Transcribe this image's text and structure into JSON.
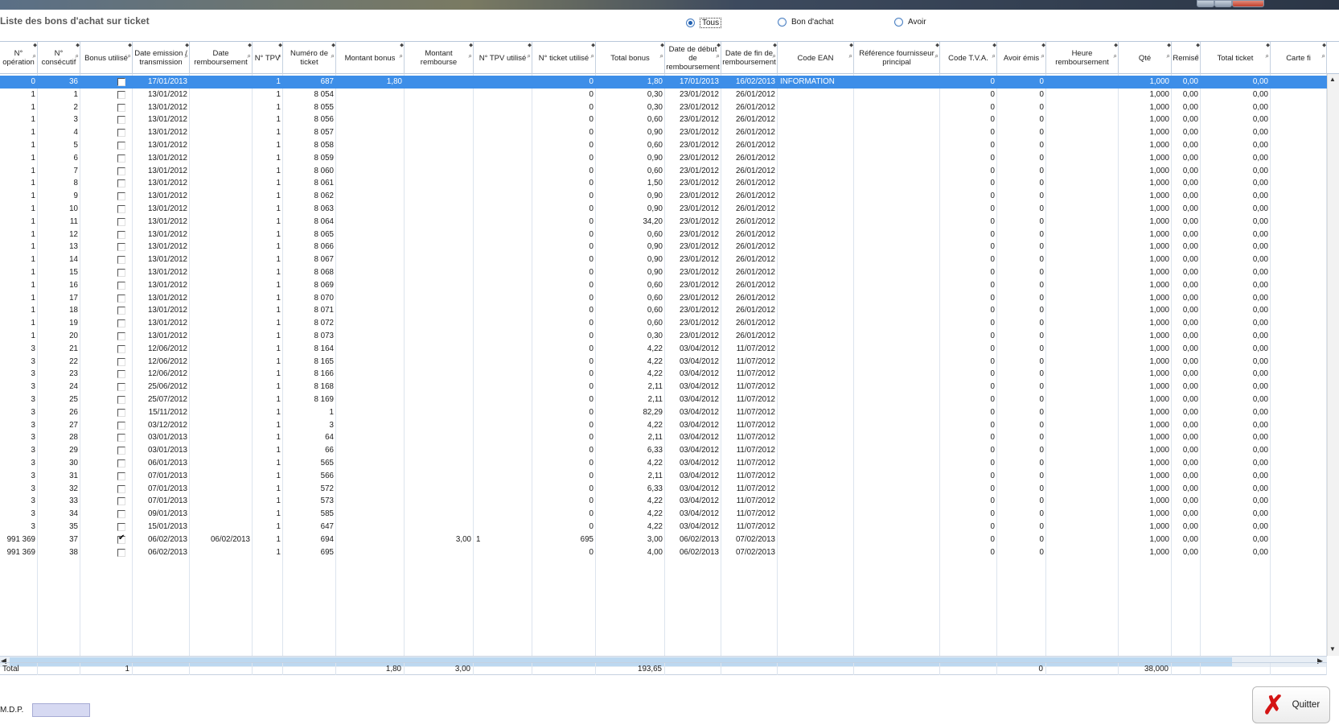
{
  "page": {
    "title": "Liste des bons d'achat sur ticket"
  },
  "filters": [
    {
      "label": "Tous",
      "selected": true
    },
    {
      "label": "Bon d'achat",
      "selected": false
    },
    {
      "label": "Avoir",
      "selected": false
    }
  ],
  "columns": [
    "N° opération",
    "N° consécutif",
    "Bonus utilisé",
    "Date emission / transmission",
    "Date remboursement",
    "N° TPV",
    "Numéro de ticket",
    "Montant bonus",
    "Montant rembourse",
    "N° TPV utilisé",
    "N° ticket utilisé",
    "Total bonus",
    "Date de début de remboursement",
    "Date de fin de remboursement",
    "Code EAN",
    "Référence fournisseur principal",
    "Code T.V.A.",
    "Avoir émis",
    "Heure remboursement",
    "Qté",
    "Remise",
    "Total ticket",
    "Carte fi"
  ],
  "rows": [
    [
      "0",
      "36",
      false,
      "17/01/2013",
      "",
      "1",
      "687",
      "1,80",
      "",
      "",
      "0",
      "1,80",
      "17/01/2013",
      "16/02/2013",
      "INFORMATION",
      "",
      "0",
      "0",
      "",
      "1,000",
      "0,00",
      "0,00"
    ],
    [
      "1",
      "1",
      false,
      "13/01/2012",
      "",
      "1",
      "8 054",
      "",
      "",
      "",
      "0",
      "0,30",
      "23/01/2012",
      "26/01/2012",
      "",
      "",
      "0",
      "0",
      "",
      "1,000",
      "0,00",
      "0,00"
    ],
    [
      "1",
      "2",
      false,
      "13/01/2012",
      "",
      "1",
      "8 055",
      "",
      "",
      "",
      "0",
      "0,30",
      "23/01/2012",
      "26/01/2012",
      "",
      "",
      "0",
      "0",
      "",
      "1,000",
      "0,00",
      "0,00"
    ],
    [
      "1",
      "3",
      false,
      "13/01/2012",
      "",
      "1",
      "8 056",
      "",
      "",
      "",
      "0",
      "0,60",
      "23/01/2012",
      "26/01/2012",
      "",
      "",
      "0",
      "0",
      "",
      "1,000",
      "0,00",
      "0,00"
    ],
    [
      "1",
      "4",
      false,
      "13/01/2012",
      "",
      "1",
      "8 057",
      "",
      "",
      "",
      "0",
      "0,90",
      "23/01/2012",
      "26/01/2012",
      "",
      "",
      "0",
      "0",
      "",
      "1,000",
      "0,00",
      "0,00"
    ],
    [
      "1",
      "5",
      false,
      "13/01/2012",
      "",
      "1",
      "8 058",
      "",
      "",
      "",
      "0",
      "0,60",
      "23/01/2012",
      "26/01/2012",
      "",
      "",
      "0",
      "0",
      "",
      "1,000",
      "0,00",
      "0,00"
    ],
    [
      "1",
      "6",
      false,
      "13/01/2012",
      "",
      "1",
      "8 059",
      "",
      "",
      "",
      "0",
      "0,90",
      "23/01/2012",
      "26/01/2012",
      "",
      "",
      "0",
      "0",
      "",
      "1,000",
      "0,00",
      "0,00"
    ],
    [
      "1",
      "7",
      false,
      "13/01/2012",
      "",
      "1",
      "8 060",
      "",
      "",
      "",
      "0",
      "0,60",
      "23/01/2012",
      "26/01/2012",
      "",
      "",
      "0",
      "0",
      "",
      "1,000",
      "0,00",
      "0,00"
    ],
    [
      "1",
      "8",
      false,
      "13/01/2012",
      "",
      "1",
      "8 061",
      "",
      "",
      "",
      "0",
      "1,50",
      "23/01/2012",
      "26/01/2012",
      "",
      "",
      "0",
      "0",
      "",
      "1,000",
      "0,00",
      "0,00"
    ],
    [
      "1",
      "9",
      false,
      "13/01/2012",
      "",
      "1",
      "8 062",
      "",
      "",
      "",
      "0",
      "0,90",
      "23/01/2012",
      "26/01/2012",
      "",
      "",
      "0",
      "0",
      "",
      "1,000",
      "0,00",
      "0,00"
    ],
    [
      "1",
      "10",
      false,
      "13/01/2012",
      "",
      "1",
      "8 063",
      "",
      "",
      "",
      "0",
      "0,90",
      "23/01/2012",
      "26/01/2012",
      "",
      "",
      "0",
      "0",
      "",
      "1,000",
      "0,00",
      "0,00"
    ],
    [
      "1",
      "11",
      false,
      "13/01/2012",
      "",
      "1",
      "8 064",
      "",
      "",
      "",
      "0",
      "34,20",
      "23/01/2012",
      "26/01/2012",
      "",
      "",
      "0",
      "0",
      "",
      "1,000",
      "0,00",
      "0,00"
    ],
    [
      "1",
      "12",
      false,
      "13/01/2012",
      "",
      "1",
      "8 065",
      "",
      "",
      "",
      "0",
      "0,60",
      "23/01/2012",
      "26/01/2012",
      "",
      "",
      "0",
      "0",
      "",
      "1,000",
      "0,00",
      "0,00"
    ],
    [
      "1",
      "13",
      false,
      "13/01/2012",
      "",
      "1",
      "8 066",
      "",
      "",
      "",
      "0",
      "0,90",
      "23/01/2012",
      "26/01/2012",
      "",
      "",
      "0",
      "0",
      "",
      "1,000",
      "0,00",
      "0,00"
    ],
    [
      "1",
      "14",
      false,
      "13/01/2012",
      "",
      "1",
      "8 067",
      "",
      "",
      "",
      "0",
      "0,90",
      "23/01/2012",
      "26/01/2012",
      "",
      "",
      "0",
      "0",
      "",
      "1,000",
      "0,00",
      "0,00"
    ],
    [
      "1",
      "15",
      false,
      "13/01/2012",
      "",
      "1",
      "8 068",
      "",
      "",
      "",
      "0",
      "0,90",
      "23/01/2012",
      "26/01/2012",
      "",
      "",
      "0",
      "0",
      "",
      "1,000",
      "0,00",
      "0,00"
    ],
    [
      "1",
      "16",
      false,
      "13/01/2012",
      "",
      "1",
      "8 069",
      "",
      "",
      "",
      "0",
      "0,60",
      "23/01/2012",
      "26/01/2012",
      "",
      "",
      "0",
      "0",
      "",
      "1,000",
      "0,00",
      "0,00"
    ],
    [
      "1",
      "17",
      false,
      "13/01/2012",
      "",
      "1",
      "8 070",
      "",
      "",
      "",
      "0",
      "0,60",
      "23/01/2012",
      "26/01/2012",
      "",
      "",
      "0",
      "0",
      "",
      "1,000",
      "0,00",
      "0,00"
    ],
    [
      "1",
      "18",
      false,
      "13/01/2012",
      "",
      "1",
      "8 071",
      "",
      "",
      "",
      "0",
      "0,60",
      "23/01/2012",
      "26/01/2012",
      "",
      "",
      "0",
      "0",
      "",
      "1,000",
      "0,00",
      "0,00"
    ],
    [
      "1",
      "19",
      false,
      "13/01/2012",
      "",
      "1",
      "8 072",
      "",
      "",
      "",
      "0",
      "0,60",
      "23/01/2012",
      "26/01/2012",
      "",
      "",
      "0",
      "0",
      "",
      "1,000",
      "0,00",
      "0,00"
    ],
    [
      "1",
      "20",
      false,
      "13/01/2012",
      "",
      "1",
      "8 073",
      "",
      "",
      "",
      "0",
      "0,30",
      "23/01/2012",
      "26/01/2012",
      "",
      "",
      "0",
      "0",
      "",
      "1,000",
      "0,00",
      "0,00"
    ],
    [
      "3",
      "21",
      false,
      "12/06/2012",
      "",
      "1",
      "8 164",
      "",
      "",
      "",
      "0",
      "4,22",
      "03/04/2012",
      "11/07/2012",
      "",
      "",
      "0",
      "0",
      "",
      "1,000",
      "0,00",
      "0,00"
    ],
    [
      "3",
      "22",
      false,
      "12/06/2012",
      "",
      "1",
      "8 165",
      "",
      "",
      "",
      "0",
      "4,22",
      "03/04/2012",
      "11/07/2012",
      "",
      "",
      "0",
      "0",
      "",
      "1,000",
      "0,00",
      "0,00"
    ],
    [
      "3",
      "23",
      false,
      "12/06/2012",
      "",
      "1",
      "8 166",
      "",
      "",
      "",
      "0",
      "4,22",
      "03/04/2012",
      "11/07/2012",
      "",
      "",
      "0",
      "0",
      "",
      "1,000",
      "0,00",
      "0,00"
    ],
    [
      "3",
      "24",
      false,
      "25/06/2012",
      "",
      "1",
      "8 168",
      "",
      "",
      "",
      "0",
      "2,11",
      "03/04/2012",
      "11/07/2012",
      "",
      "",
      "0",
      "0",
      "",
      "1,000",
      "0,00",
      "0,00"
    ],
    [
      "3",
      "25",
      false,
      "25/07/2012",
      "",
      "1",
      "8 169",
      "",
      "",
      "",
      "0",
      "2,11",
      "03/04/2012",
      "11/07/2012",
      "",
      "",
      "0",
      "0",
      "",
      "1,000",
      "0,00",
      "0,00"
    ],
    [
      "3",
      "26",
      false,
      "15/11/2012",
      "",
      "1",
      "1",
      "",
      "",
      "",
      "0",
      "82,29",
      "03/04/2012",
      "11/07/2012",
      "",
      "",
      "0",
      "0",
      "",
      "1,000",
      "0,00",
      "0,00"
    ],
    [
      "3",
      "27",
      false,
      "03/12/2012",
      "",
      "1",
      "3",
      "",
      "",
      "",
      "0",
      "4,22",
      "03/04/2012",
      "11/07/2012",
      "",
      "",
      "0",
      "0",
      "",
      "1,000",
      "0,00",
      "0,00"
    ],
    [
      "3",
      "28",
      false,
      "03/01/2013",
      "",
      "1",
      "64",
      "",
      "",
      "",
      "0",
      "2,11",
      "03/04/2012",
      "11/07/2012",
      "",
      "",
      "0",
      "0",
      "",
      "1,000",
      "0,00",
      "0,00"
    ],
    [
      "3",
      "29",
      false,
      "03/01/2013",
      "",
      "1",
      "66",
      "",
      "",
      "",
      "0",
      "6,33",
      "03/04/2012",
      "11/07/2012",
      "",
      "",
      "0",
      "0",
      "",
      "1,000",
      "0,00",
      "0,00"
    ],
    [
      "3",
      "30",
      false,
      "06/01/2013",
      "",
      "1",
      "565",
      "",
      "",
      "",
      "0",
      "4,22",
      "03/04/2012",
      "11/07/2012",
      "",
      "",
      "0",
      "0",
      "",
      "1,000",
      "0,00",
      "0,00"
    ],
    [
      "3",
      "31",
      false,
      "07/01/2013",
      "",
      "1",
      "566",
      "",
      "",
      "",
      "0",
      "2,11",
      "03/04/2012",
      "11/07/2012",
      "",
      "",
      "0",
      "0",
      "",
      "1,000",
      "0,00",
      "0,00"
    ],
    [
      "3",
      "32",
      false,
      "07/01/2013",
      "",
      "1",
      "572",
      "",
      "",
      "",
      "0",
      "6,33",
      "03/04/2012",
      "11/07/2012",
      "",
      "",
      "0",
      "0",
      "",
      "1,000",
      "0,00",
      "0,00"
    ],
    [
      "3",
      "33",
      false,
      "07/01/2013",
      "",
      "1",
      "573",
      "",
      "",
      "",
      "0",
      "4,22",
      "03/04/2012",
      "11/07/2012",
      "",
      "",
      "0",
      "0",
      "",
      "1,000",
      "0,00",
      "0,00"
    ],
    [
      "3",
      "34",
      false,
      "09/01/2013",
      "",
      "1",
      "585",
      "",
      "",
      "",
      "0",
      "4,22",
      "03/04/2012",
      "11/07/2012",
      "",
      "",
      "0",
      "0",
      "",
      "1,000",
      "0,00",
      "0,00"
    ],
    [
      "3",
      "35",
      false,
      "15/01/2013",
      "",
      "1",
      "647",
      "",
      "",
      "",
      "0",
      "4,22",
      "03/04/2012",
      "11/07/2012",
      "",
      "",
      "0",
      "0",
      "",
      "1,000",
      "0,00",
      "0,00"
    ],
    [
      "991 369",
      "37",
      true,
      "06/02/2013",
      "06/02/2013",
      "1",
      "694",
      "",
      "3,00",
      "1",
      "695",
      "3,00",
      "06/02/2013",
      "07/02/2013",
      "",
      "",
      "0",
      "0",
      "",
      "1,000",
      "0,00",
      "0,00"
    ],
    [
      "991 369",
      "38",
      false,
      "06/02/2013",
      "",
      "1",
      "695",
      "",
      "",
      "",
      "0",
      "4,00",
      "06/02/2013",
      "07/02/2013",
      "",
      "",
      "0",
      "0",
      "",
      "1,000",
      "0,00",
      "0,00"
    ]
  ],
  "totals": {
    "label": "Total",
    "bonus_utilise": "1",
    "montant_bonus": "1,80",
    "montant_rembourse": "3,00",
    "total_bonus": "193,65",
    "avoir_emis": "0",
    "qte": "38,000"
  },
  "footer": {
    "mdp_label": "M.D.P.",
    "mdp_value": "",
    "quit_label": "Quitter"
  },
  "colors": {
    "selection": "#3d8ee8",
    "scrollbar": "#bcd8f0",
    "quit_icon": "#d41414"
  }
}
